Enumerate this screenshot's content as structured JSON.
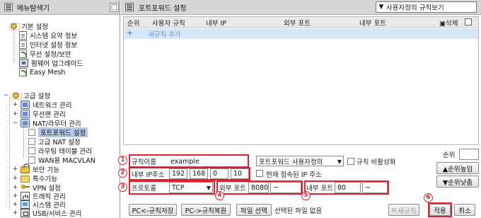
{
  "sidebar": {
    "title": "메뉴탐색기",
    "close_label": "□",
    "basic_group": "기본 설정",
    "basic_items": [
      "시스템 요약 정보",
      "인터넷 설정 정보",
      "무선 설정/보안",
      "펌웨어 업그레이드",
      "Easy Mesh"
    ],
    "advanced_group": "고급 설정",
    "advanced_items": {
      "network": "네트워크 관리",
      "wlan": "무선랜 관리",
      "nat": "NAT/라우터 관리",
      "nat_children": [
        "포트포워드 설정",
        "고급 NAT 설정",
        "라우팅 테이블 관리",
        "WAN용 MACVLAN"
      ],
      "security": "보안 기능",
      "special": "특수기능",
      "vpn": "VPN 설정",
      "traffic": "트래픽 관리",
      "system": "시스템 관리",
      "usb": "USB/서비스 관리"
    },
    "selected": "포트포워드 설정"
  },
  "main": {
    "title": "포트포워드 설정",
    "view_select": "사용자정의 규칙보기",
    "columns": [
      "순위",
      "사용자 규칙",
      "내부 IP",
      "외부 포트",
      "내부 포트",
      "삭제"
    ],
    "add_rule": "새규칙 추가",
    "form": {
      "rule_name_label": "규칙이름",
      "rule_name_value": "example",
      "rule_type": "포트포워드 사용자정의",
      "disable_label": "규칙 비활성화",
      "ip_label": "내부 IP주소",
      "ip": [
        "192",
        "168",
        "0",
        "10"
      ],
      "current_ip_label": "현재 접속된 IP 주소",
      "protocol_label": "프로토콜",
      "protocol_value": "TCP",
      "ext_port_label": "외부 포트",
      "ext_port_from": "8080",
      "ext_port_to": "",
      "int_port_label": "내부 포트",
      "int_port_from": "80",
      "int_port_to": "",
      "tilde": "~",
      "priority_label": "순위",
      "priority_value": "",
      "priority_up": "▲순위높임",
      "priority_down": "▼순위낮춤"
    },
    "buttons": {
      "pc_save": "PC<-규칙저장",
      "pc_restore": "PC->규칙복원",
      "file_select": "파일 선택",
      "file_none": "선택된 파일 없음",
      "new_rule": "새규칙",
      "apply": "적용",
      "cancel": "취소"
    },
    "markers": [
      "1",
      "2",
      "3",
      "4",
      "5",
      "6"
    ]
  }
}
